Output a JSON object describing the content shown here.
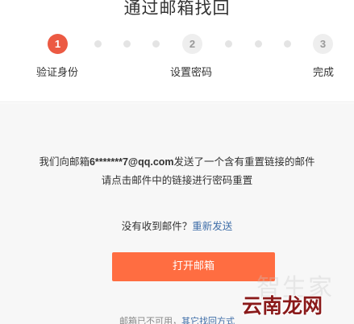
{
  "page": {
    "title": "通过邮箱找回"
  },
  "steps": [
    {
      "number": "1",
      "label": "验证身份",
      "state": "active"
    },
    {
      "number": "2",
      "label": "设置密码",
      "state": "inactive"
    },
    {
      "number": "3",
      "label": "完成",
      "state": "inactive"
    }
  ],
  "message": {
    "sent_prefix": "我们向邮箱",
    "email": "6*******7@qq.com",
    "sent_suffix": "发送了一个含有重置链接的邮件",
    "instruction": "请点击邮件中的链接进行密码重置"
  },
  "resend": {
    "question": "没有收到邮件？",
    "link": "重新发送"
  },
  "open_mailbox_button": "打开邮箱",
  "footer": {
    "text": "邮箱已不可用，",
    "link": "其它找回方式"
  },
  "watermark": {
    "ghost_text": "智生家",
    "main_text": "云南龙网"
  },
  "colors": {
    "active_step": "#ec5a43",
    "button": "#ff6d41",
    "link": "#3f6ea8"
  }
}
